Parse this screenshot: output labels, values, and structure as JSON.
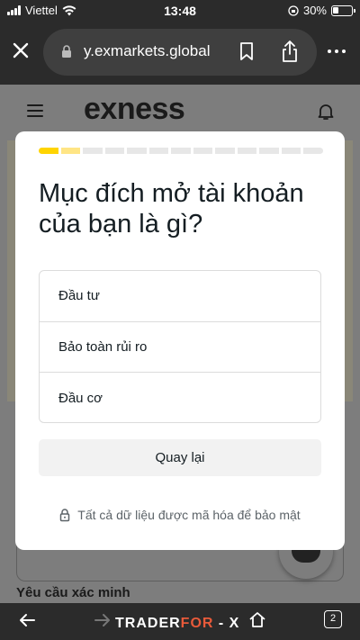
{
  "status": {
    "carrier": "Viettel",
    "time": "13:48",
    "battery": "30%"
  },
  "browser": {
    "url": "y.exmarkets.global"
  },
  "site": {
    "logo": "exness",
    "verify_heading": "Yêu cầu xác minh"
  },
  "modal": {
    "title": "Mục đích mở tài khoản của bạn là gì?",
    "progress_total": 13,
    "progress_completed": 1.5,
    "options": [
      "Đầu tư",
      "Bảo toàn rủi ro",
      "Đầu cơ"
    ],
    "back_label": "Quay lại",
    "security_note": "Tất cả dữ liệu được mã hóa để bảo mật"
  },
  "toolbar": {
    "tab_count": "2",
    "watermark": {
      "part1": "TRADER",
      "part2": "FOR",
      "part3": "X"
    }
  },
  "colors": {
    "progress": "#ffd400",
    "progress_partial": "#ffe585",
    "browser_chrome": "#2b2b2b"
  }
}
